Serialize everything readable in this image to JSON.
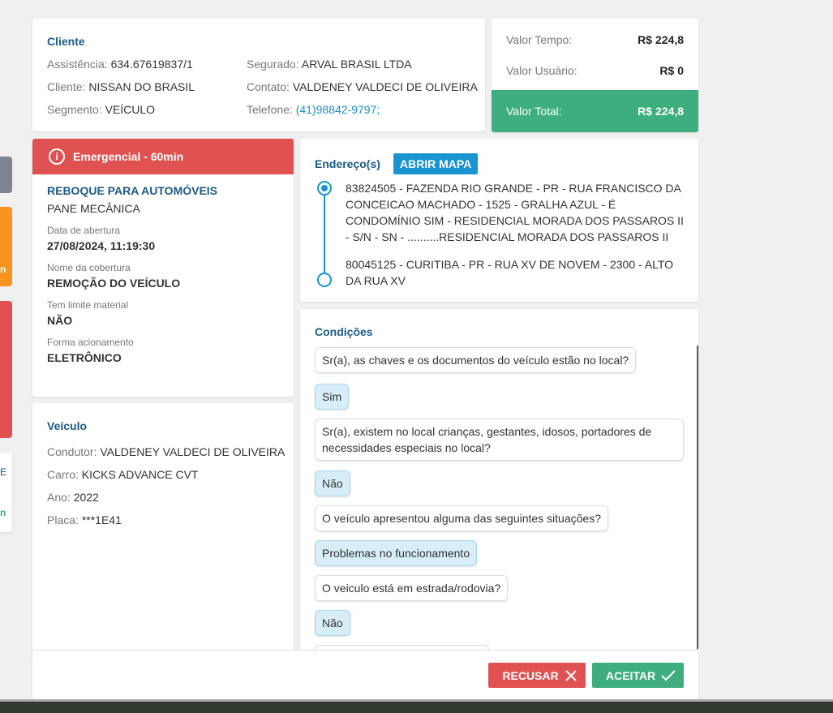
{
  "client": {
    "title": "Cliente",
    "assistencia_label": "Assistência:",
    "assistencia_value": "634.67619837/1",
    "cliente_label": "Cliente:",
    "cliente_value": "NISSAN DO BRASIL",
    "segmento_label": "Segmento:",
    "segmento_value": "VEÍCULO",
    "segurado_label": "Segurado:",
    "segurado_value": "ARVAL BRASIL LTDA",
    "contato_label": "Contato:",
    "contato_value": "VALDENEY VALDECI DE OLIVEIRA",
    "telefone_label": "Telefone:",
    "telefone_value": "(41)98842-9797;"
  },
  "values": {
    "tempo_label": "Valor Tempo:",
    "tempo_value": "R$ 224,8",
    "usuario_label": "Valor Usuário:",
    "usuario_value": "R$ 0",
    "total_label": "Valor Total:",
    "total_value": "R$ 224,8"
  },
  "service": {
    "banner": "Emergencial - 60min",
    "banner_icon": "info-icon",
    "type": "REBOQUE PARA AUTOMÓVEIS",
    "problem": "PANE MECÂNICA",
    "fields": [
      {
        "label": "Data de abertura",
        "value": "27/08/2024, 11:19:30"
      },
      {
        "label": "Nome da cobertura",
        "value": "REMOÇÃO DO VEÍCULO"
      },
      {
        "label": "Tem limite material",
        "value": "NÃO"
      },
      {
        "label": "Forma acionamento",
        "value": "ELETRÔNICO"
      }
    ]
  },
  "vehicle": {
    "title": "Veículo",
    "condutor_label": "Condutor:",
    "condutor_value": "VALDENEY VALDECI DE OLIVEIRA",
    "carro_label": "Carro:",
    "carro_value": "KICKS ADVANCE CVT",
    "ano_label": "Ano:",
    "ano_value": "2022",
    "placa_label": "Placa:",
    "placa_value": "***1E41"
  },
  "address": {
    "title": "Endereço(s)",
    "map_button": "ABRIR MAPA",
    "origin": "83824505 - FAZENDA RIO GRANDE - PR - RUA FRANCISCO DA CONCEICAO MACHADO - 1525 - GRALHA AZUL - É CONDOMÍNIO SIM - RESIDENCIAL MORADA DOS PASSAROS II - S/N - SN - ..........RESIDENCIAL MORADA DOS PASSAROS II",
    "destination": "80045125 - CURITIBA - PR - RUA XV DE NOVEM - 2300 - ALTO DA RUA XV"
  },
  "conditions": {
    "title": "Condições",
    "items": [
      {
        "question": "Sr(a), as chaves e os documentos do veículo estão no local?",
        "answer": "Sim"
      },
      {
        "question": "Sr(a), existem no local crianças, gestantes, idosos, portadores de necessidades especiais no local?",
        "answer": "Não"
      },
      {
        "question": "O veículo apresentou alguma das seguintes situações?",
        "answer": "Problemas no funcionamento"
      },
      {
        "question": "O veiculo está em estrada/rodovia?",
        "answer": "Não"
      }
    ]
  },
  "footer": {
    "reject_label": "RECUSAR",
    "accept_label": "ACEITAR"
  },
  "side_cards": {
    "orange_text": "n",
    "white_text_1": "E",
    "white_text_2": "n"
  },
  "colors": {
    "primary_title": "#1b5a88",
    "accent_blue": "#1a93d1",
    "danger": "#e05252",
    "success": "#3fae7e",
    "orange": "#f7941d"
  }
}
